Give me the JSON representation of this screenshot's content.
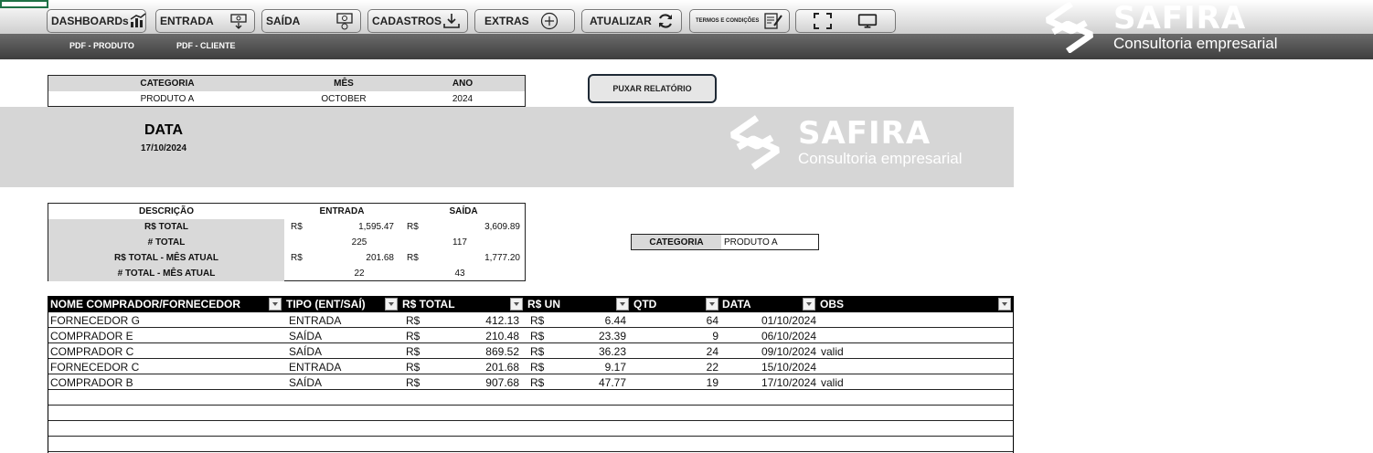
{
  "toolbar": {
    "buttons": [
      {
        "label": "DASHBOARDs",
        "icon": "dashboard-chart-icon"
      },
      {
        "label": "ENTRADA",
        "icon": "cash-in-icon"
      },
      {
        "label": "SAÍDA",
        "icon": "cash-out-icon"
      },
      {
        "label": "CADASTROS",
        "icon": "download-tray-icon"
      },
      {
        "label": "EXTRAS",
        "icon": "plus-circle-icon"
      },
      {
        "label": "ATUALIZAR",
        "icon": "refresh-icon"
      },
      {
        "label": "TERMOS E CONDIÇÕES",
        "icon": "document-sign-icon"
      }
    ],
    "fullscreen_icon": "fullscreen-icon",
    "monitor_icon": "monitor-icon"
  },
  "subnav": {
    "pdf_produto": "PDF - PRODUTO",
    "pdf_cliente": "PDF - CLIENTE"
  },
  "logo": {
    "name": "SAFIRA",
    "tagline": "Consultoria empresarial"
  },
  "filter": {
    "headers": [
      "CATEGORIA",
      "MÊS",
      "ANO"
    ],
    "values": [
      "PRODUTO A",
      "OCTOBER",
      "2024"
    ]
  },
  "pull_report_label": "PUXAR RELATÓRIO",
  "date_block": {
    "label": "DATA",
    "value": "17/10/2024"
  },
  "summary": {
    "headers": [
      "DESCRIÇÃO",
      "ENTRADA",
      "SAÍDA"
    ],
    "rows": [
      {
        "label": "R$ TOTAL",
        "entrada": "1,595.47",
        "saida": "3,609.89",
        "currency": true
      },
      {
        "label": "# TOTAL",
        "entrada": "225",
        "saida": "117",
        "currency": false
      },
      {
        "label": "R$ TOTAL - MÊS ATUAL",
        "entrada": "201.68",
        "saida": "1,777.20",
        "currency": true
      },
      {
        "label": "# TOTAL - MÊS ATUAL",
        "entrada": "22",
        "saida": "43",
        "currency": false
      }
    ],
    "currency_symbol": "R$"
  },
  "category_box": {
    "label": "CATEGORIA",
    "value": "PRODUTO A"
  },
  "table": {
    "columns": [
      "NOME COMPRADOR/FORNECEDOR",
      "TIPO (ENT/SAÍ)",
      "R$ TOTAL",
      "R$ UN",
      "QTD",
      "DATA",
      "OBS"
    ],
    "rows": [
      {
        "nome": "FORNECEDOR G",
        "tipo": "ENTRADA",
        "total": "412.13",
        "un": "6.44",
        "qtd": "64",
        "data": "01/10/2024",
        "obs": ""
      },
      {
        "nome": "COMPRADOR E",
        "tipo": "SAÍDA",
        "total": "210.48",
        "un": "23.39",
        "qtd": "9",
        "data": "06/10/2024",
        "obs": ""
      },
      {
        "nome": "COMPRADOR C",
        "tipo": "SAÍDA",
        "total": "869.52",
        "un": "36.23",
        "qtd": "24",
        "data": "09/10/2024",
        "obs": "valid"
      },
      {
        "nome": "FORNECEDOR C",
        "tipo": "ENTRADA",
        "total": "201.68",
        "un": "9.17",
        "qtd": "22",
        "data": "15/10/2024",
        "obs": ""
      },
      {
        "nome": "COMPRADOR B",
        "tipo": "SAÍDA",
        "total": "907.68",
        "un": "47.77",
        "qtd": "19",
        "data": "17/10/2024",
        "obs": "valid"
      }
    ],
    "empty_rows": 4,
    "currency_symbol": "R$"
  }
}
